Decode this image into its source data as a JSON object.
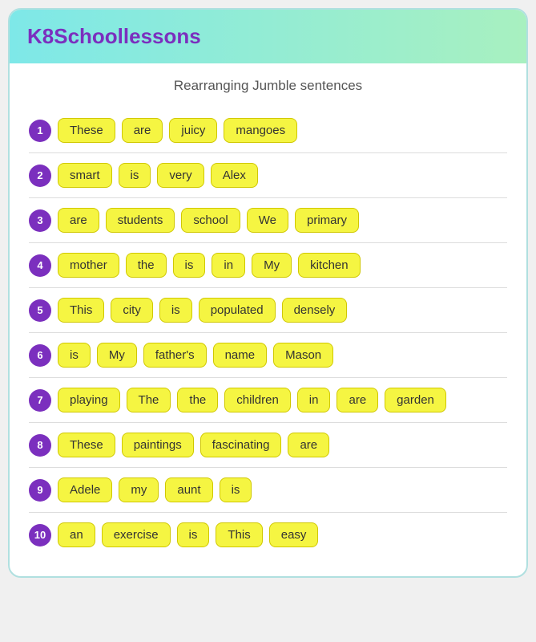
{
  "header": {
    "title": "K8Schoollessons"
  },
  "page_title": "Rearranging Jumble sentences",
  "sentences": [
    {
      "number": "1",
      "words": [
        "These",
        "are",
        "juicy",
        "mangoes"
      ]
    },
    {
      "number": "2",
      "words": [
        "smart",
        "is",
        "very",
        "Alex"
      ]
    },
    {
      "number": "3",
      "words": [
        "are",
        "students",
        "school",
        "We",
        "primary"
      ]
    },
    {
      "number": "4",
      "words": [
        "mother",
        "the",
        "is",
        "in",
        "My",
        "kitchen"
      ]
    },
    {
      "number": "5",
      "words": [
        "This",
        "city",
        "is",
        "populated",
        "densely"
      ]
    },
    {
      "number": "6",
      "words": [
        "is",
        "My",
        "father's",
        "name",
        "Mason"
      ]
    },
    {
      "number": "7",
      "words": [
        "playing",
        "The",
        "the",
        "children",
        "in",
        "are",
        "garden"
      ]
    },
    {
      "number": "8",
      "words": [
        "These",
        "paintings",
        "fascinating",
        "are"
      ]
    },
    {
      "number": "9",
      "words": [
        "Adele",
        "my",
        "aunt",
        "is"
      ]
    },
    {
      "number": "10",
      "words": [
        "an",
        "exercise",
        "is",
        "This",
        "easy"
      ]
    }
  ]
}
